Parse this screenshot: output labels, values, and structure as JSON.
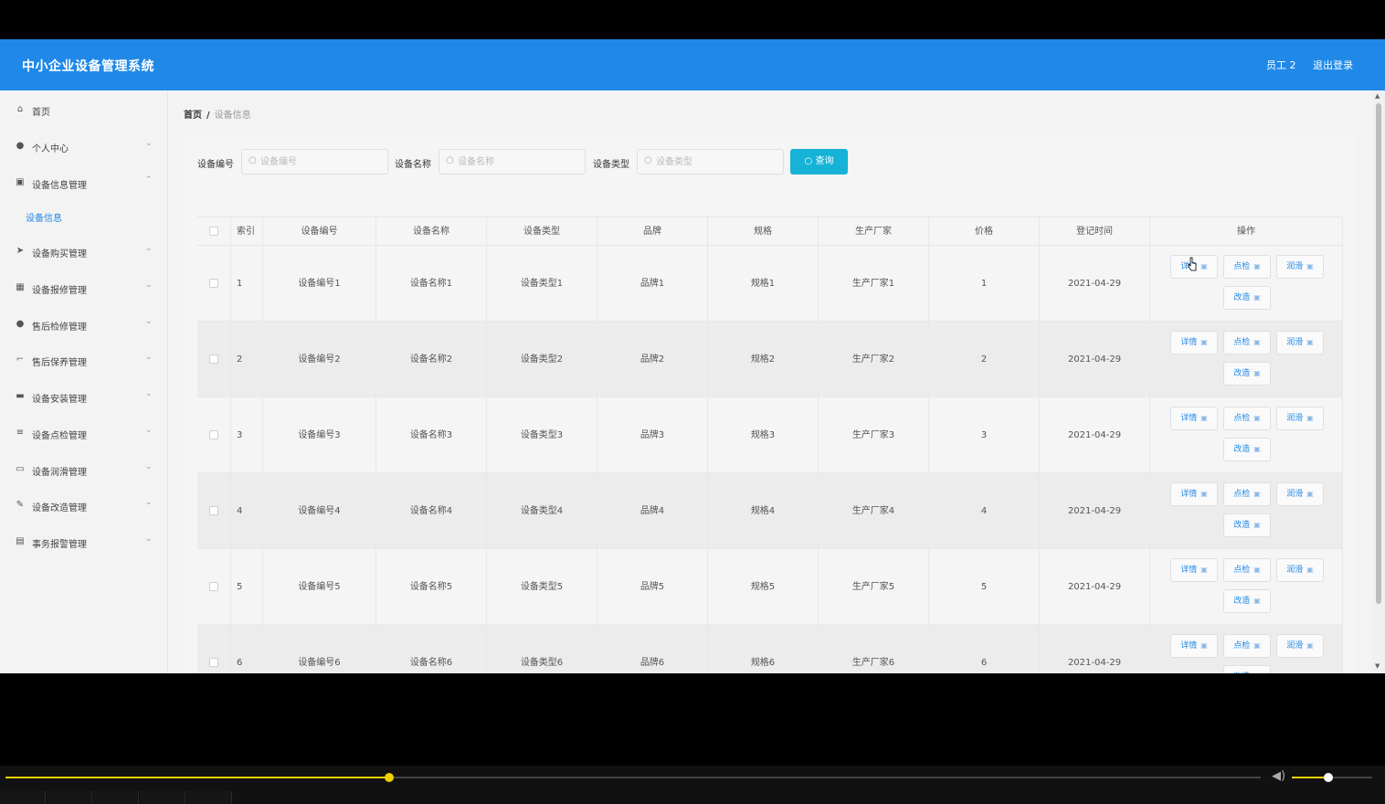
{
  "header": {
    "app_title": "中小企业设备管理系统",
    "user": "员工 2",
    "logout": "退出登录"
  },
  "sidebar": {
    "items": [
      {
        "icon": "home-icon",
        "glyph": "⌂",
        "label": "首页",
        "chevron": ""
      },
      {
        "icon": "user-icon",
        "glyph": "●",
        "label": "个人中心",
        "chevron": "⌄"
      },
      {
        "icon": "clipboard-icon",
        "glyph": "▣",
        "label": "设备信息管理",
        "chevron": "⌃"
      },
      {
        "icon": "send-icon",
        "glyph": "➤",
        "label": "设备购买管理",
        "chevron": "⌄"
      },
      {
        "icon": "grid-icon",
        "glyph": "▦",
        "label": "设备报修管理",
        "chevron": "⌄"
      },
      {
        "icon": "user-icon",
        "glyph": "●",
        "label": "售后检修管理",
        "chevron": "⌄"
      },
      {
        "icon": "crop-icon",
        "glyph": "⌐",
        "label": "售后保养管理",
        "chevron": "⌄"
      },
      {
        "icon": "briefcase-icon",
        "glyph": "▬",
        "label": "设备安装管理",
        "chevron": "⌄"
      },
      {
        "icon": "list-icon",
        "glyph": "≡",
        "label": "设备点检管理",
        "chevron": "⌄"
      },
      {
        "icon": "message-icon",
        "glyph": "▭",
        "label": "设备润滑管理",
        "chevron": "⌄"
      },
      {
        "icon": "edit-icon",
        "glyph": "✎",
        "label": "设备改造管理",
        "chevron": "⌄"
      },
      {
        "icon": "document-icon",
        "glyph": "▤",
        "label": "事务报警管理",
        "chevron": "⌄"
      }
    ],
    "active_sub": "设备信息"
  },
  "breadcrumb": {
    "home": "首页",
    "sep": "/",
    "current": "设备信息"
  },
  "search": {
    "fields": [
      {
        "label": "设备编号",
        "placeholder": "设备编号",
        "value": ""
      },
      {
        "label": "设备名称",
        "placeholder": "设备名称",
        "value": ""
      },
      {
        "label": "设备类型",
        "placeholder": "设备类型",
        "value": ""
      }
    ],
    "query_label": "查询"
  },
  "table": {
    "headers": [
      "",
      "索引",
      "设备编号",
      "设备名称",
      "设备类型",
      "品牌",
      "规格",
      "生产厂家",
      "价格",
      "登记时间",
      "操作"
    ],
    "rows": [
      {
        "index": "1",
        "code": "设备编号1",
        "name": "设备名称1",
        "type": "设备类型1",
        "brand": "品牌1",
        "spec": "规格1",
        "maker": "生产厂家1",
        "price": "1",
        "date": "2021-04-29"
      },
      {
        "index": "2",
        "code": "设备编号2",
        "name": "设备名称2",
        "type": "设备类型2",
        "brand": "品牌2",
        "spec": "规格2",
        "maker": "生产厂家2",
        "price": "2",
        "date": "2021-04-29"
      },
      {
        "index": "3",
        "code": "设备编号3",
        "name": "设备名称3",
        "type": "设备类型3",
        "brand": "品牌3",
        "spec": "规格3",
        "maker": "生产厂家3",
        "price": "3",
        "date": "2021-04-29"
      },
      {
        "index": "4",
        "code": "设备编号4",
        "name": "设备名称4",
        "type": "设备类型4",
        "brand": "品牌4",
        "spec": "规格4",
        "maker": "生产厂家4",
        "price": "4",
        "date": "2021-04-29"
      },
      {
        "index": "5",
        "code": "设备编号5",
        "name": "设备名称5",
        "type": "设备类型5",
        "brand": "品牌5",
        "spec": "规格5",
        "maker": "生产厂家5",
        "price": "5",
        "date": "2021-04-29"
      },
      {
        "index": "6",
        "code": "设备编号6",
        "name": "设备名称6",
        "type": "设备类型6",
        "brand": "品牌6",
        "spec": "规格6",
        "maker": "生产厂家6",
        "price": "6",
        "date": "2021-04-29"
      }
    ],
    "actions": [
      "详情",
      "点检",
      "润滑",
      "改造"
    ]
  },
  "player": {
    "progress": 0.306,
    "volume": 0.45
  },
  "colors": {
    "accent": "#2089e8",
    "query": "#17b3d6",
    "player_accent": "#f0d000"
  }
}
